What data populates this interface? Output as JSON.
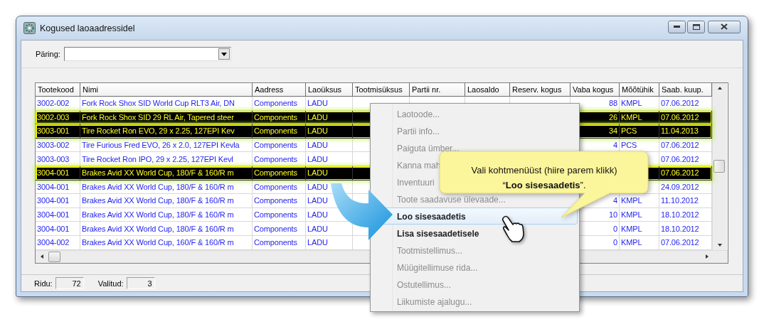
{
  "window": {
    "title": "Kogused laoaadressidel"
  },
  "query": {
    "label": "Päring:"
  },
  "table": {
    "columns": [
      "Tootekood",
      "Nimi",
      "Aadress",
      "Laoüksus",
      "Tootmisüksus",
      "Partii nr.",
      "Laosaldo",
      "Reserv. kogus",
      "Vaba kogus",
      "Mõõtühik",
      "Saab. kuup."
    ],
    "rows": [
      {
        "code": "3002-002",
        "name": "Fork Rock Shox SID World Cup RLT3 Air, DN",
        "address": "Components",
        "unit": "LADU",
        "free_qty": "88",
        "uom": "KMPL",
        "date": "07.06.2012",
        "selected": false
      },
      {
        "code": "3002-003",
        "name": "Fork Rock Shox SID 29 RL Air, Tapered steer",
        "address": "Components",
        "unit": "LADU",
        "free_qty": "26",
        "uom": "KMPL",
        "date": "07.06.2012",
        "selected": true
      },
      {
        "code": "3003-001",
        "name": "Tire Rocket Ron EVO, 29 x 2.25, 127EPI Kev",
        "address": "Components",
        "unit": "LADU",
        "free_qty": "34",
        "uom": "PCS",
        "date": "11.04.2013",
        "selected": true
      },
      {
        "code": "3003-002",
        "name": "Tire Furious Fred EVO, 26 x 2.0, 127EPI Kevla",
        "address": "Components",
        "unit": "LADU",
        "free_qty": "4",
        "uom": "PCS",
        "date": "07.06.2012",
        "selected": false
      },
      {
        "code": "3003-003",
        "name": "Tire Rocket Ron IPO, 29 x 2.25, 127EPI Kevl",
        "address": "Components",
        "unit": "LADU",
        "date": "07.06.2012",
        "selected": false
      },
      {
        "code": "3004-001",
        "name": "Brakes Avid XX World Cup, 180/F & 160/R m",
        "address": "Components",
        "unit": "LADU",
        "date": "07.06.2012",
        "selected": true
      },
      {
        "code": "3004-001",
        "name": "Brakes Avid XX World Cup, 180/F & 160/R m",
        "address": "Components",
        "unit": "LADU",
        "date": "24.09.2012",
        "selected": false
      },
      {
        "code": "3004-001",
        "name": "Brakes Avid XX World Cup, 180/F & 160/R m",
        "address": "Components",
        "unit": "LADU",
        "free_qty": "4",
        "uom": "KMPL",
        "date": "11.10.2012",
        "selected": false
      },
      {
        "code": "3004-001",
        "name": "Brakes Avid XX World Cup, 180/F & 160/R m",
        "address": "Components",
        "unit": "LADU",
        "free_qty": "10",
        "uom": "KMPL",
        "date": "18.10.2012",
        "selected": false
      },
      {
        "code": "3004-001",
        "name": "Brakes Avid XX World Cup, 180/F & 160/R m",
        "address": "Components",
        "unit": "LADU",
        "free_qty": "0",
        "uom": "KMPL",
        "date": "18.10.2012",
        "selected": false
      },
      {
        "code": "3004-002",
        "name": "Brakes Avid XX World Cup, 160/F & 160/R m",
        "address": "Components",
        "unit": "LADU",
        "free_qty": "0",
        "uom": "KMPL",
        "date": "07.06.2012",
        "selected": false
      }
    ]
  },
  "status_bar": {
    "rows_label": "Ridu:",
    "rows_value": "72",
    "selected_label": "Valitud:",
    "selected_value": "3"
  },
  "context_menu": {
    "items": [
      {
        "label": "Laotoode...",
        "disabled": true,
        "selected": false
      },
      {
        "label": "Partii info...",
        "disabled": true,
        "selected": false
      },
      {
        "label": "Paiguta ümber...",
        "disabled": true,
        "selected": false
      },
      {
        "label": "Kanna mah",
        "disabled": true,
        "selected": false
      },
      {
        "label": "Inventuuri",
        "disabled": true,
        "selected": false
      },
      {
        "label": "Toote saadavuse ülevaade...",
        "disabled": true,
        "selected": false
      },
      {
        "label": "Loo sisesaadetis",
        "disabled": false,
        "selected": true
      },
      {
        "label": "Lisa sisesaadetisele",
        "disabled": false,
        "selected": false
      },
      {
        "label": "Tootmistellimus...",
        "disabled": true,
        "selected": false
      },
      {
        "label": "Müügitellimuse rida...",
        "disabled": true,
        "selected": false
      },
      {
        "label": "Ostutellimus...",
        "disabled": true,
        "selected": false
      },
      {
        "label": "Liikumiste ajalugu...",
        "disabled": true,
        "selected": false
      }
    ]
  },
  "callout": {
    "text": "Vali kohtmenüüst (hiire parem klikk)\n“**Loo sisesaadetis**”."
  }
}
